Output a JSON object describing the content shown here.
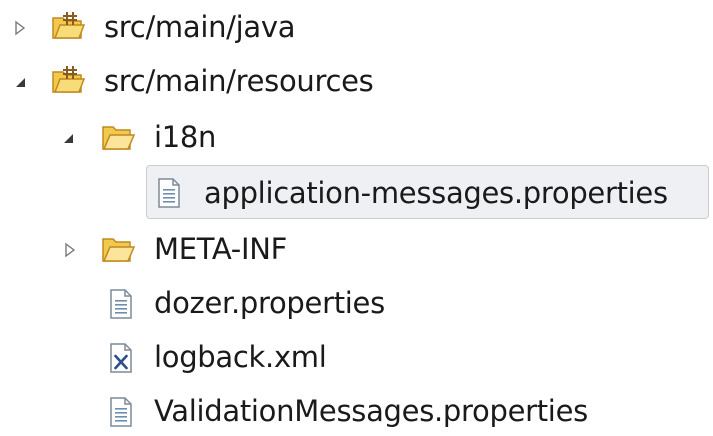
{
  "tree": {
    "items": [
      {
        "label": "src/main/java",
        "icon": "source-folder-icon",
        "expanded": false
      },
      {
        "label": "src/main/resources",
        "icon": "source-folder-icon",
        "expanded": true
      },
      {
        "label": "i18n",
        "icon": "folder-open-icon",
        "expanded": true
      },
      {
        "label": "application-messages.properties",
        "icon": "properties-file-icon",
        "selected": true
      },
      {
        "label": "META-INF",
        "icon": "folder-open-icon",
        "expanded": false
      },
      {
        "label": "dozer.properties",
        "icon": "properties-file-icon"
      },
      {
        "label": "logback.xml",
        "icon": "xml-file-icon"
      },
      {
        "label": "ValidationMessages.properties",
        "icon": "properties-file-icon"
      }
    ]
  },
  "colors": {
    "folder": "#f2c94c",
    "folder_stroke": "#c08a1e",
    "package_brown": "#8a5a1e",
    "selection_bg": "#eef0f3",
    "selection_border": "#c9ccd1",
    "twisty": "#6b6b6b"
  }
}
